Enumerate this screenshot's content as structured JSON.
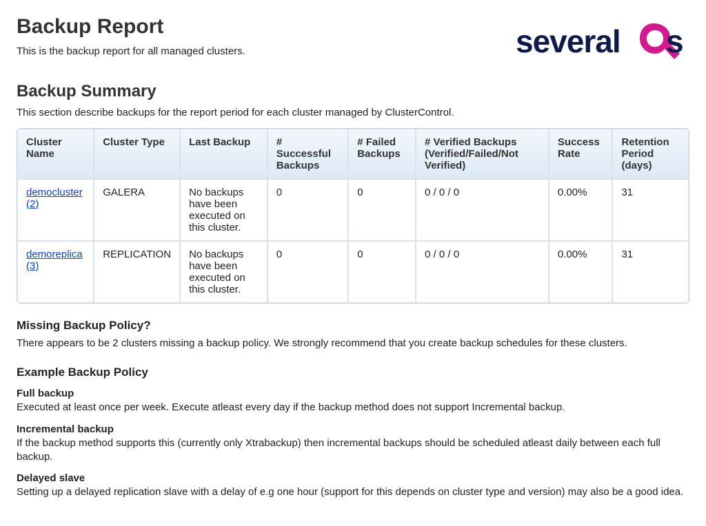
{
  "brand": {
    "name": "several9s"
  },
  "title": "Backup Report",
  "intro": "This is the backup report for all managed clusters.",
  "summary": {
    "heading": "Backup Summary",
    "desc": "This section describe backups for the report period for each cluster managed by ClusterControl."
  },
  "table": {
    "headers": {
      "cluster_name": "Cluster Name",
      "cluster_type": "Cluster Type",
      "last_backup": "Last Backup",
      "successful": "# Successful Backups",
      "failed": "# Failed Backups",
      "verified": "# Verified Backups (Verified/Failed/Not Verified)",
      "success_rate": "Success Rate",
      "retention": "Retention Period (days)"
    },
    "rows": [
      {
        "cluster_name": "democluster (2)",
        "cluster_type": "GALERA",
        "last_backup": "No backups have been executed on this cluster.",
        "successful": "0",
        "failed": "0",
        "verified": "0 / 0 / 0",
        "success_rate": "0.00%",
        "retention": "31"
      },
      {
        "cluster_name": "demoreplica (3)",
        "cluster_type": "REPLICATION",
        "last_backup": "No backups have been executed on this cluster.",
        "successful": "0",
        "failed": "0",
        "verified": "0 / 0 / 0",
        "success_rate": "0.00%",
        "retention": "31"
      }
    ]
  },
  "missing_policy": {
    "heading": "Missing Backup Policy?",
    "text": "There appears to be 2 clusters missing a backup policy. We strongly recommend that you create backup schedules for these clusters."
  },
  "example_policy": {
    "heading": "Example Backup Policy",
    "items": [
      {
        "title": "Full backup",
        "text": "Executed at least once per week. Execute atleast every day if the backup method does not support Incremental backup."
      },
      {
        "title": "Incremental backup",
        "text": "If the backup method supports this (currently only Xtrabackup) then incremental backups should be scheduled atleast daily between each full backup."
      },
      {
        "title": "Delayed slave",
        "text": "Setting up a delayed replication slave with a delay of e.g one hour (support for this depends on cluster type and version) may also be a good idea."
      }
    ]
  }
}
